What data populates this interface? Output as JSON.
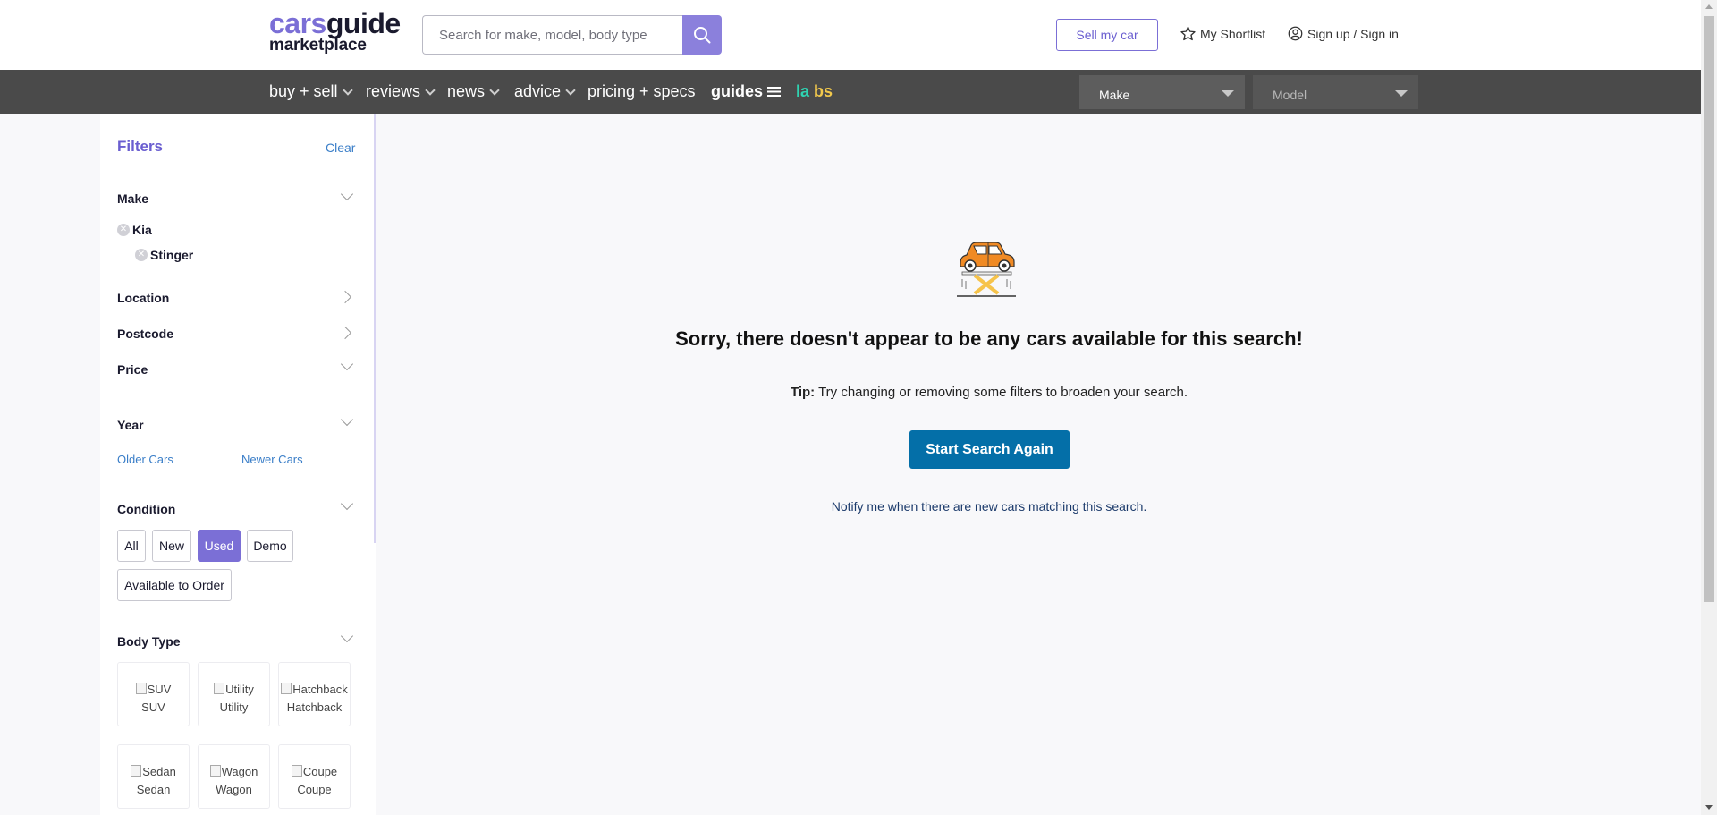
{
  "header": {
    "logo": {
      "part1": "cars",
      "part2": "guide",
      "line2": "marketplace"
    },
    "search": {
      "placeholder": "Search for make, model, body type",
      "value": ""
    },
    "sell_label": "Sell my car",
    "shortlist_label": "My Shortlist",
    "signin_label": "Sign up / Sign in"
  },
  "nav": {
    "items": [
      {
        "label": "buy + sell"
      },
      {
        "label": "reviews"
      },
      {
        "label": "news"
      },
      {
        "label": "advice"
      },
      {
        "label": "pricing + specs"
      },
      {
        "label": "guides"
      },
      {
        "label_a": "la",
        "label_b": "bs"
      }
    ],
    "make_select": "Make",
    "model_select": "Model"
  },
  "filters": {
    "title": "Filters",
    "clear_label": "Clear",
    "make": {
      "label": "Make",
      "chips": [
        "Kia",
        "Stinger"
      ]
    },
    "location_label": "Location",
    "postcode_label": "Postcode",
    "price_label": "Price",
    "year": {
      "label": "Year",
      "older": "Older Cars",
      "newer": "Newer Cars"
    },
    "condition": {
      "label": "Condition",
      "options": [
        "All",
        "New",
        "Used",
        "Demo",
        "Available to Order"
      ],
      "selected": "Used"
    },
    "body_type": {
      "label": "Body Type",
      "options": [
        "SUV",
        "Utility",
        "Hatchback",
        "Sedan",
        "Wagon",
        "Coupe"
      ]
    }
  },
  "results": {
    "empty_title": "Sorry, there doesn't appear to be any cars available for this search!",
    "tip_bold": "Tip:",
    "tip_text": " Try changing or removing some filters to broaden your search.",
    "start_again_label": "Start Search Again",
    "notify_label": "Notify me when there are new cars matching this search."
  },
  "colors": {
    "brand_purple": "#7b6fd6",
    "nav_bg": "#4a4a4a",
    "primary_button": "#046fa8",
    "link_blue": "#3a7ec8"
  }
}
